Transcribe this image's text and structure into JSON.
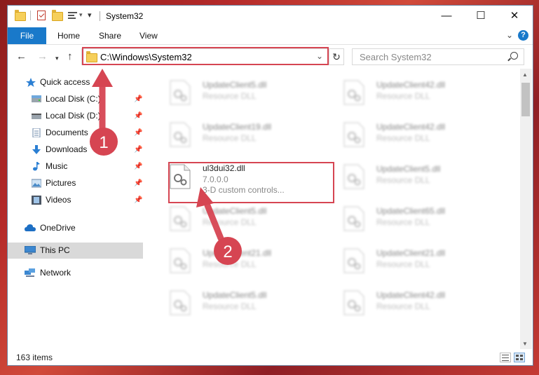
{
  "window": {
    "title": "System32",
    "minimize_glyph": "—",
    "maximize_glyph": "☐",
    "close_glyph": "✕"
  },
  "ribbon": {
    "tabs": [
      "File",
      "Home",
      "Share",
      "View"
    ],
    "help_glyph": "?"
  },
  "address": {
    "path": "C:\\Windows\\System32",
    "search_placeholder": "Search System32"
  },
  "nav": {
    "items": [
      {
        "label": "Quick access",
        "icon": "star-icon",
        "pinned": false
      },
      {
        "label": "Local Disk (C:)",
        "icon": "drive-icon",
        "pinned": true
      },
      {
        "label": "Local Disk (D:)",
        "icon": "drive-icon",
        "pinned": true
      },
      {
        "label": "Documents",
        "icon": "documents-icon",
        "pinned": true
      },
      {
        "label": "Downloads",
        "icon": "downloads-icon",
        "pinned": true
      },
      {
        "label": "Music",
        "icon": "music-icon",
        "pinned": true
      },
      {
        "label": "Pictures",
        "icon": "pictures-icon",
        "pinned": true
      },
      {
        "label": "Videos",
        "icon": "videos-icon",
        "pinned": true
      },
      {
        "label": "OneDrive",
        "icon": "onedrive-icon",
        "pinned": false
      },
      {
        "label": "This PC",
        "icon": "this-pc-icon",
        "pinned": false,
        "selected": true
      },
      {
        "label": "Network",
        "icon": "network-icon",
        "pinned": false
      }
    ]
  },
  "files": {
    "left": [
      {
        "name": "UpdateClient5.dll",
        "desc": "Resource DLL"
      },
      {
        "name": "UpdateClient19.dll",
        "desc": "Resource DLL"
      },
      {
        "name": "ul3dui32.dll",
        "desc": "7.0.0.0",
        "desc2": "3-D custom controls...",
        "highlighted": true
      },
      {
        "name": "UpdateClient5.dll",
        "desc": "Resource DLL"
      },
      {
        "name": "UpdateClient21.dll",
        "desc": "Resource DLL"
      },
      {
        "name": "UpdateClient5.dll",
        "desc": "Resource DLL"
      }
    ],
    "right": [
      {
        "name": "UpdateClient42.dll",
        "desc": "Resource DLL"
      },
      {
        "name": "UpdateClient42.dll",
        "desc": "Resource DLL"
      },
      {
        "name": "UpdateClient5.dll",
        "desc": "Resource DLL"
      },
      {
        "name": "UpdateClient65.dll",
        "desc": "Resource DLL"
      },
      {
        "name": "UpdateClient21.dll",
        "desc": "Resource DLL"
      },
      {
        "name": "UpdateClient42.dll",
        "desc": "Resource DLL"
      }
    ]
  },
  "status": {
    "items_count": "163 items"
  },
  "annotations": {
    "step1": "1",
    "step2": "2",
    "color": "#d64552"
  }
}
